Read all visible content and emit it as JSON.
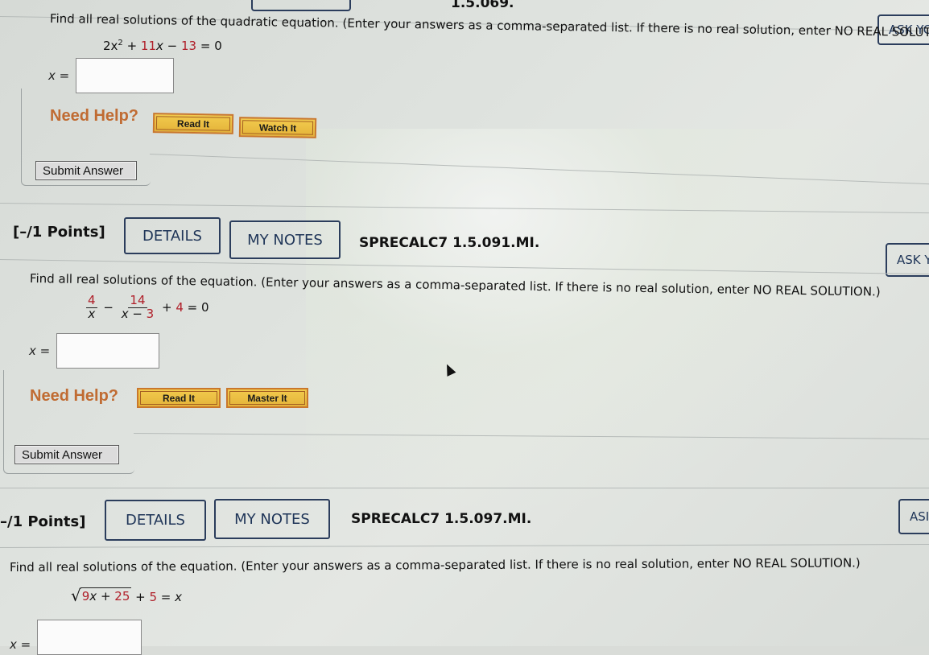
{
  "top_fragment": {
    "code": "1.5.069."
  },
  "questions": [
    {
      "id": "q-069",
      "prompt": "Find all real solutions of the quadratic equation. (Enter your answers as a comma-separated list. If there is no real solution, enter NO REAL SOLUTION.)",
      "equation": {
        "terms": [
          "2x",
          "2",
          " + ",
          "11",
          "x",
          " − ",
          "13",
          " = 0"
        ]
      },
      "answer_label": "x =",
      "answer_value": "",
      "need_help": "Need Help?",
      "help_buttons": [
        "Read It",
        "Watch It"
      ],
      "submit_label": "Submit Answer",
      "ask_label": "ASK YO"
    },
    {
      "id": "q-091",
      "points": "[–/1 Points]",
      "details_label": "DETAILS",
      "notes_label": "MY NOTES",
      "code": "SPRECALC7 1.5.091.MI.",
      "ask_label": "ASK Y",
      "prompt": "Find all real solutions of the equation. (Enter your answers as a comma-separated list. If there is no real solution, enter NO REAL SOLUTION.)",
      "equation": {
        "frac1_num": "4",
        "frac1_den": "x",
        "minus": "−",
        "frac2_num": "14",
        "frac2_den_var": "x − ",
        "frac2_den_const": "3",
        "plus": "+ ",
        "const": "4",
        "rhs": " = 0"
      },
      "answer_label": "x =",
      "answer_value": "",
      "need_help": "Need Help?",
      "help_buttons": [
        "Read It",
        "Master It"
      ],
      "submit_label": "Submit Answer"
    },
    {
      "id": "q-097",
      "points": "–/1 Points]",
      "details_label": "DETAILS",
      "notes_label": "MY NOTES",
      "code": "SPRECALC7 1.5.097.MI.",
      "ask_label": "ASI",
      "prompt": "Find all real solutions of the equation. (Enter your answers as a comma-separated list. If there is no real solution, enter NO REAL SOLUTION.)",
      "equation": {
        "radicand_a": "9",
        "radicand_var": "x + ",
        "radicand_b": "25",
        "plus": " + ",
        "const": "5",
        "rhs": " = x"
      },
      "answer_label": "x =",
      "answer_value": ""
    }
  ]
}
